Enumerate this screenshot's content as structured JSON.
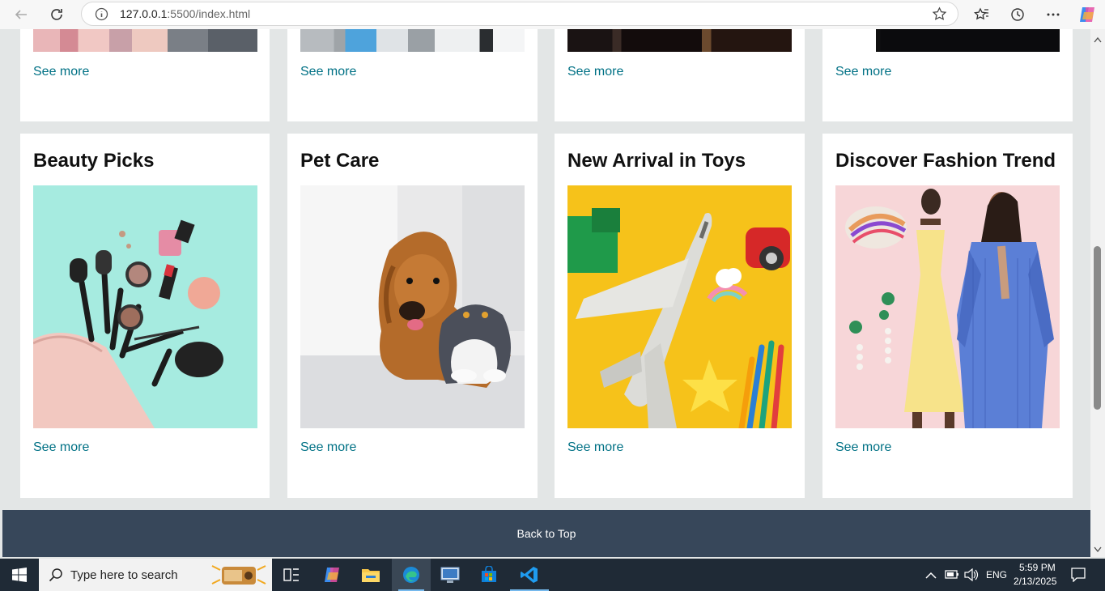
{
  "browser": {
    "url_host": "127.0.0.1",
    "url_rest": ":5500/index.html"
  },
  "top_row": {
    "see_more": [
      "See more",
      "See more",
      "See more",
      "See more"
    ]
  },
  "cards": [
    {
      "title": "Beauty Picks",
      "link": "See more",
      "image": "makeup-products"
    },
    {
      "title": "Pet Care",
      "link": "See more",
      "image": "dog-and-cat"
    },
    {
      "title": "New Arrival in Toys",
      "link": "See more",
      "image": "toy-airplane"
    },
    {
      "title": "Discover Fashion Trend",
      "link": "See more",
      "image": "fashion-models"
    }
  ],
  "footer": {
    "back_to_top": "Back to Top"
  },
  "taskbar": {
    "search_placeholder": "Type here to search",
    "language": "ENG",
    "time": "5:59 PM",
    "date": "2/13/2025"
  },
  "colors": {
    "link": "#007185",
    "back_to_top_bg": "#37475a",
    "page_bg": "#e3e6e6"
  }
}
